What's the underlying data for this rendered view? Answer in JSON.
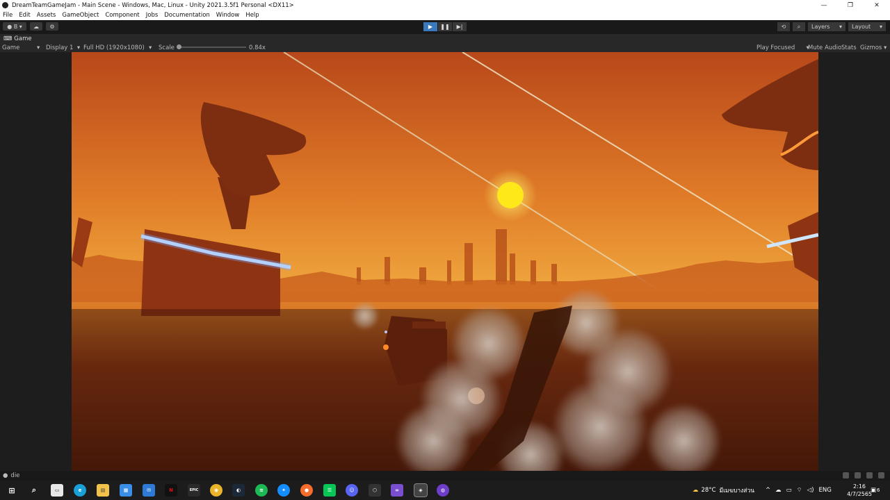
{
  "window": {
    "title": "DreamTeamGameJam - Main Scene - Windows, Mac, Linux - Unity 2021.3.5f1 Personal <DX11>",
    "controls": {
      "minimize": "—",
      "restore": "❐",
      "close": "✕"
    }
  },
  "menu": [
    "File",
    "Edit",
    "Assets",
    "GameObject",
    "Component",
    "Jobs",
    "Documentation",
    "Window",
    "Help"
  ],
  "toolbar": {
    "account_label": "B",
    "play_controls": [
      "▶",
      "❚❚",
      "▶|"
    ],
    "layers_label": "Layers",
    "layout_label": "Layout"
  },
  "tab": {
    "label": "Game"
  },
  "game_bar": {
    "mode": "Game",
    "display": "Display 1",
    "resolution": "Full HD (1920x1080)",
    "scale_label": "Scale",
    "scale_value": "0.84x",
    "play_focused": "Play Focused",
    "mute_audio": "Mute Audio",
    "stats": "Stats",
    "gizmos": "Gizmos"
  },
  "status": {
    "message": "die"
  },
  "taskbar": {
    "weather": "28°C",
    "weather_desc": "มีเมฆบางส่วน",
    "language": "ENG",
    "time": "2:16",
    "date": "4/7/2565",
    "notifications": "6",
    "apps": [
      "search-icon",
      "taskview-icon",
      "edge-icon",
      "explorer-icon",
      "store-icon",
      "mail-icon",
      "netflix-icon",
      "epic-icon",
      "chrome-icon",
      "steam-icon",
      "spotify-icon",
      "battlenet-icon",
      "origin-icon",
      "line-icon",
      "discord-icon",
      "unity-hub-icon",
      "visualstudio-icon",
      "unity-icon",
      "github-icon"
    ]
  },
  "colors": {
    "play_active": "#3a79bb",
    "sky_top": "#b8481a",
    "sky_mid": "#e9a43a",
    "sun": "#ffe81a",
    "neon": "#9fd0ff"
  }
}
